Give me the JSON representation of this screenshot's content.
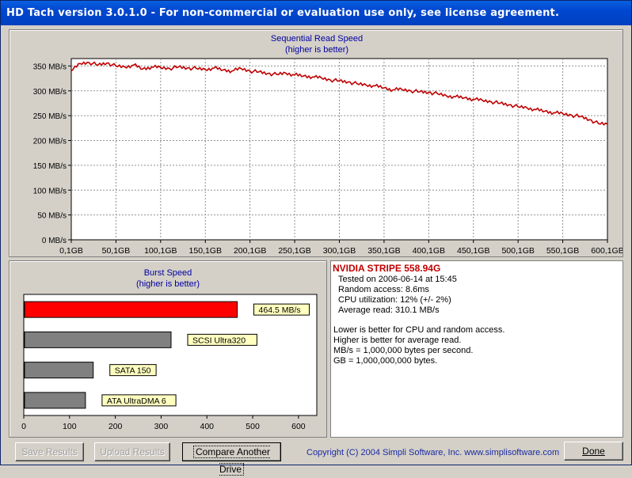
{
  "window": {
    "title": "HD Tach version 3.0.1.0  - For non-commercial or evaluation use only, see license agreement."
  },
  "colors": {
    "series": "#c00000",
    "burst_highlight": "#ff0000",
    "bar_gray": "#808080",
    "label_bg": "#ffffc0",
    "title_blue": "#0000a0"
  },
  "chart_data": [
    {
      "type": "line",
      "title": "Sequential Read Speed",
      "subtitle": "(higher is better)",
      "x_ticks": [
        "0,1GB",
        "50,1GB",
        "100,1GB",
        "150,1GB",
        "200,1GB",
        "250,1GB",
        "300,1GB",
        "350,1GB",
        "400,1GB",
        "450,1GB",
        "500,1GB",
        "550,1GB",
        "600,1GB"
      ],
      "y_ticks": [
        "350 MB/s",
        "300 MB/s",
        "250 MB/s",
        "200 MB/s",
        "150 MB/s",
        "100 MB/s",
        "50 MB/s",
        "0 MB/s"
      ],
      "xlim": [
        0.1,
        600.1
      ],
      "ylim": [
        0,
        365
      ],
      "x": [
        0.1,
        10,
        20,
        30,
        40,
        50,
        60,
        70,
        80,
        90,
        100,
        110,
        120,
        130,
        140,
        150,
        160,
        170,
        180,
        190,
        200,
        210,
        220,
        230,
        240,
        250,
        260,
        270,
        280,
        290,
        300,
        310,
        320,
        330,
        340,
        350,
        360,
        370,
        380,
        390,
        400,
        410,
        420,
        430,
        440,
        450,
        460,
        470,
        480,
        490,
        500,
        510,
        520,
        530,
        540,
        550,
        560,
        570,
        580,
        590,
        600.1
      ],
      "values": [
        340,
        355,
        357,
        352,
        356,
        350,
        348,
        352,
        344,
        348,
        347,
        345,
        348,
        346,
        345,
        343,
        346,
        342,
        340,
        345,
        340,
        338,
        335,
        333,
        336,
        332,
        330,
        328,
        326,
        322,
        320,
        318,
        314,
        312,
        310,
        306,
        302,
        303,
        300,
        298,
        297,
        294,
        290,
        288,
        286,
        283,
        281,
        278,
        275,
        272,
        268,
        266,
        262,
        259,
        256,
        254,
        251,
        248,
        242,
        234,
        233
      ],
      "grid": true
    },
    {
      "type": "bar",
      "orientation": "horizontal",
      "title": "Burst Speed",
      "subtitle": "(higher is better)",
      "x_ticks": [
        "0",
        "100",
        "200",
        "300",
        "400",
        "500",
        "600"
      ],
      "xlim": [
        0,
        640
      ],
      "bars": [
        {
          "label": "464.5 MB/s",
          "value": 464.5,
          "highlight": true
        },
        {
          "label": "SCSI Ultra320",
          "value": 320,
          "highlight": false
        },
        {
          "label": "SATA 150",
          "value": 150,
          "highlight": false
        },
        {
          "label": "ATA UltraDMA 6",
          "value": 133,
          "highlight": false
        }
      ]
    }
  ],
  "results": {
    "drive": "NVIDIA STRIPE 558.94G",
    "tested": "Tested on 2006-06-14 at 15:45",
    "random_access": "Random access: 8.6ms",
    "cpu": "CPU utilization: 12% (+/- 2%)",
    "average_read": "Average read: 310.1 MB/s",
    "note1": "Lower is better for CPU and random access.",
    "note2": "Higher is better for average read.",
    "note3": "MB/s = 1,000,000 bytes per second.",
    "note4": "GB = 1,000,000,000 bytes."
  },
  "buttons": {
    "save": "Save Results",
    "upload": "Upload Results",
    "compare": "Compare Another Drive",
    "done": "Done"
  },
  "footer": {
    "copyright": "Copyright (C) 2004 Simpli Software, Inc. www.simplisoftware.com"
  }
}
